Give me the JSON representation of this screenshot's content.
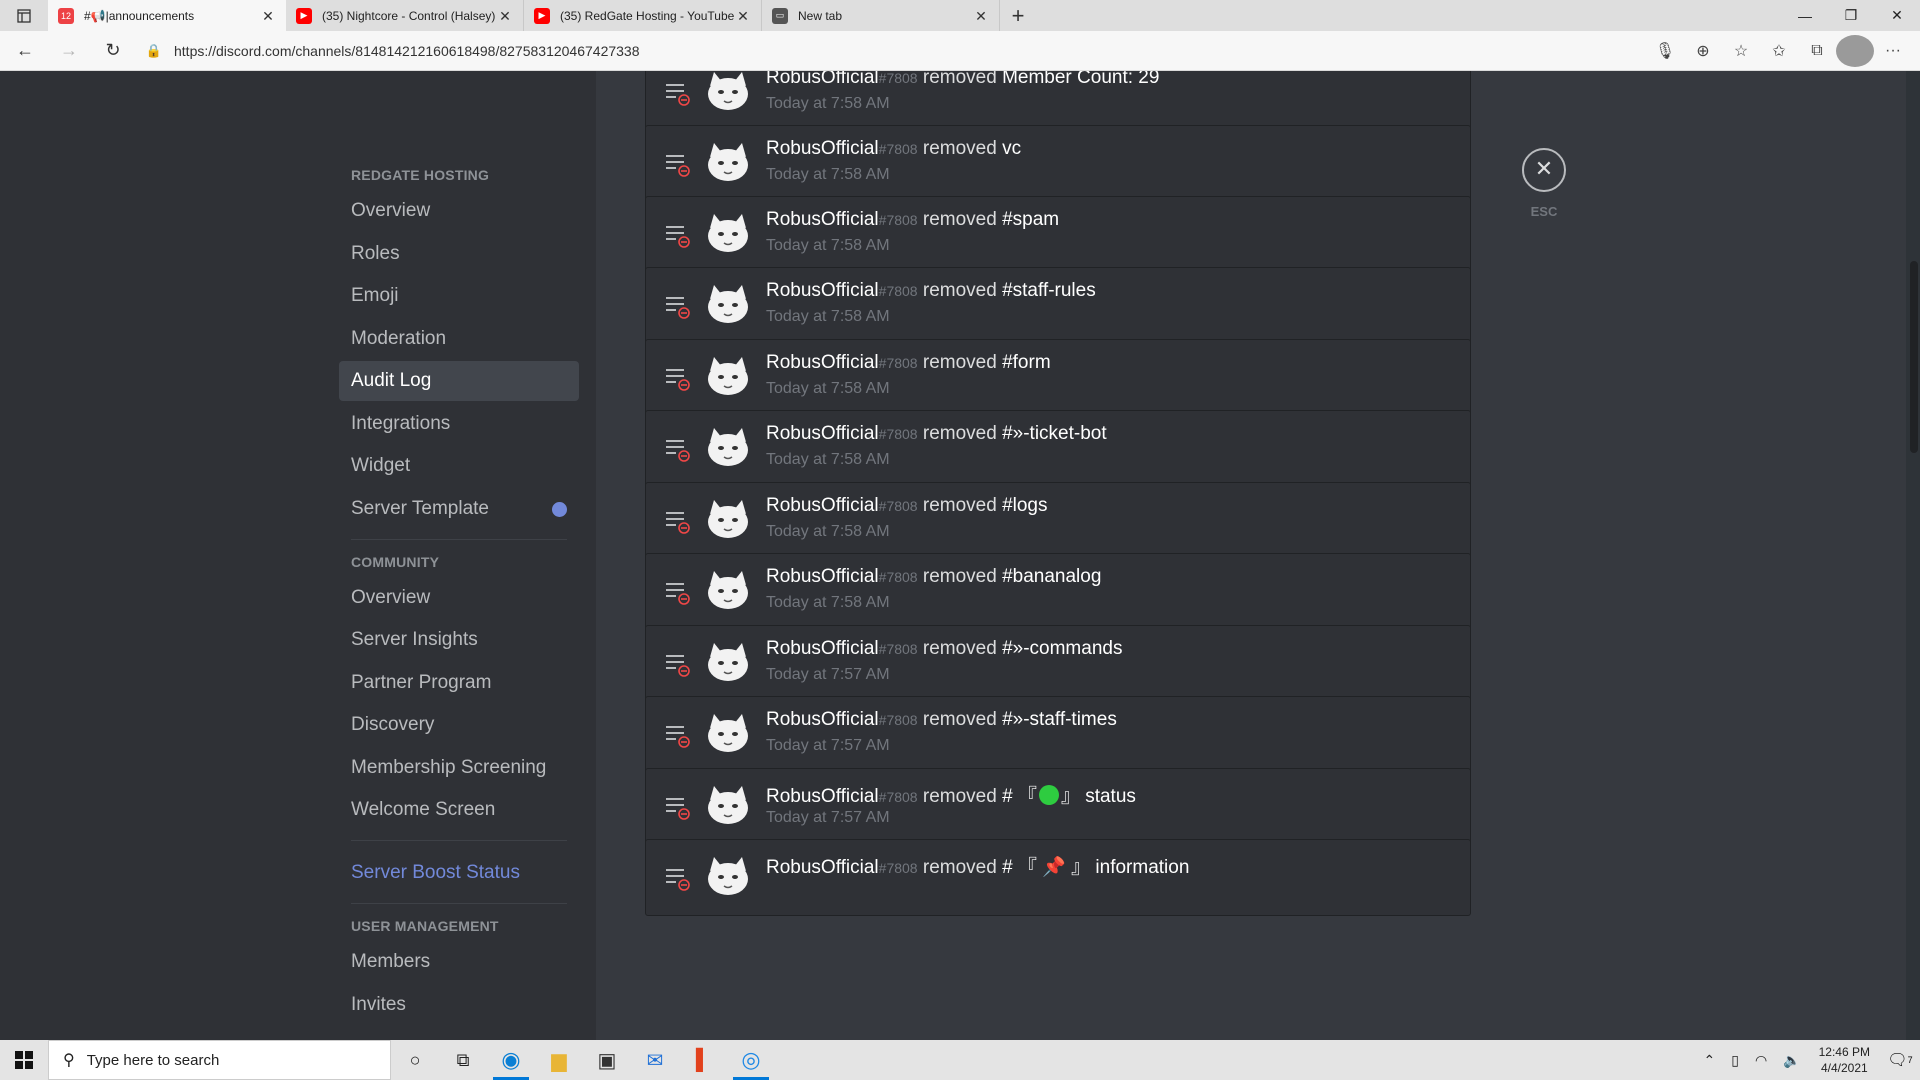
{
  "browser": {
    "tabs": [
      {
        "title": "#📢|announcements",
        "favicon_color": "#ed4245",
        "badge": "12",
        "active": true
      },
      {
        "title": "(35) Nightcore - Control (Halsey)",
        "favicon_color": "#ff0000",
        "active": false
      },
      {
        "title": "(35) RedGate Hosting - YouTube",
        "favicon_color": "#ff0000",
        "active": false
      },
      {
        "title": "New tab",
        "favicon_color": "#555555",
        "active": false
      }
    ],
    "url": "https://discord.com/channels/814814212160618498/827583120467427338"
  },
  "sidebar": {
    "sections": [
      {
        "header": "REDGATE HOSTING",
        "items": [
          "Overview",
          "Roles",
          "Emoji",
          "Moderation",
          "Audit Log",
          "Integrations",
          "Widget",
          "Server Template"
        ],
        "selected": "Audit Log"
      },
      {
        "header": "COMMUNITY",
        "items": [
          "Overview",
          "Server Insights",
          "Partner Program",
          "Discovery",
          "Membership Screening",
          "Welcome Screen"
        ]
      },
      {
        "header": "",
        "items": [
          "Server Boost Status"
        ]
      },
      {
        "header": "USER MANAGEMENT",
        "items": [
          "Members",
          "Invites"
        ]
      }
    ]
  },
  "audit_log": {
    "user": "RobusOfficial",
    "discriminator": "#7808",
    "action": "removed",
    "entries": [
      {
        "target": "Member Count: 29",
        "time": "Today at 7:58 AM"
      },
      {
        "target": "vc",
        "time": "Today at 7:58 AM"
      },
      {
        "target": "#spam",
        "time": "Today at 7:58 AM"
      },
      {
        "target": "#staff-rules",
        "time": "Today at 7:58 AM"
      },
      {
        "target": "#form",
        "time": "Today at 7:58 AM"
      },
      {
        "target": "#»-ticket-bot",
        "time": "Today at 7:58 AM"
      },
      {
        "target": "#logs",
        "time": "Today at 7:58 AM"
      },
      {
        "target": "#bananalog",
        "time": "Today at 7:58 AM"
      },
      {
        "target": "#»-commands",
        "time": "Today at 7:57 AM"
      },
      {
        "target": "#»-staff-times",
        "time": "Today at 7:57 AM"
      },
      {
        "target_prefix": "# 『",
        "target_suffix": "』 status",
        "time": "Today at 7:57 AM"
      },
      {
        "target": "# 『 📌 』 information",
        "time": ""
      }
    ]
  },
  "esc": {
    "icon": "close-icon",
    "label": "ESC"
  },
  "taskbar": {
    "search_placeholder": "Type here to search",
    "time": "12:46 PM",
    "date": "4/4/2021",
    "notification_count": "7"
  }
}
